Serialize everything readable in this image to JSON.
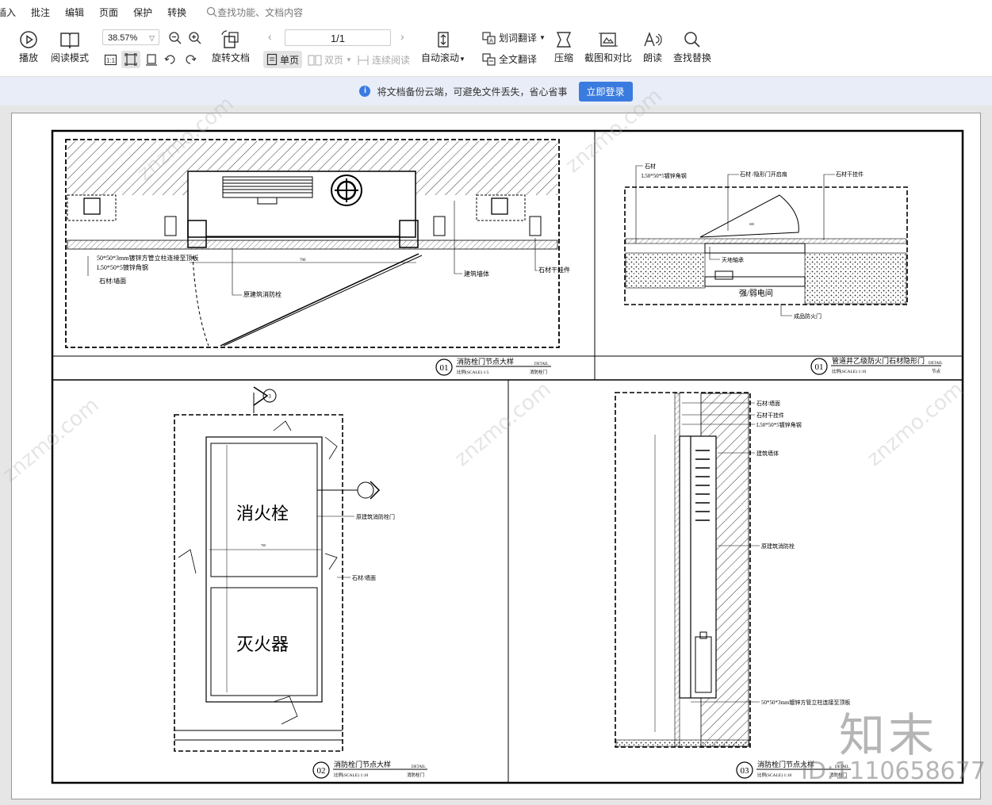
{
  "menu": {
    "items": [
      "插入",
      "批注",
      "编辑",
      "页面",
      "保护",
      "转换"
    ],
    "search_placeholder": "查找功能、文档内容"
  },
  "toolbar": {
    "play": "播放",
    "read_mode": "阅读模式",
    "zoom": "38.57%",
    "rotate": "旋转文档",
    "page": "1/1",
    "single": "单页",
    "double": "双页",
    "continuous": "连续阅读",
    "autoscroll": "自动滚动",
    "word_translate": "划词翻译",
    "full_translate": "全文翻译",
    "compress": "压缩",
    "screenshot": "截图和对比",
    "read_aloud": "朗读",
    "find_replace": "查找替换"
  },
  "notice": {
    "text": "将文档备份云端，可避免文件丢失，省心省事",
    "button": "立即登录"
  },
  "drawing": {
    "p1": {
      "labels": [
        "50*50*3mm镀锌方管立柱连接至顶板",
        "L50*50*5镀锌角钢",
        "石材/墙面",
        "原建筑消防栓",
        "建筑墙体",
        "石材干挂件"
      ],
      "dim": "700",
      "num": "01",
      "title": "消防栓门节点大样",
      "detail": "DETAIL",
      "scale": "比例(SCALE) 1:5",
      "sub": "消防栓门"
    },
    "p2": {
      "labels": [
        "石材",
        "L50*50*5镀锌角钢",
        "石材 /隐形门开启扇",
        "石材干挂件",
        "天地轴承",
        "强/弱电间",
        "成品防火门"
      ],
      "dim": "600",
      "num": "01",
      "title": "管道井乙级防火门石材隐形门",
      "detail": "DETAIL",
      "scale": "比例(SCALE) 1:10",
      "sub": "节点"
    },
    "p3": {
      "big1": "消火栓",
      "big2": "灭火器",
      "labels": [
        "原建筑消防栓门",
        "石材/墙面"
      ],
      "dim": "700",
      "marker_a": "3",
      "num": "02",
      "title": "消防栓门节点大样",
      "detail": "DETAIL",
      "scale": "比例(SCALE) 1:10",
      "sub": "消防栓门"
    },
    "p4": {
      "labels": [
        "石材/墙面",
        "石材干挂件",
        "L50*50*5镀锌角钢",
        "建筑墙体",
        "原建筑消防栓",
        "50*50*3mm镀锌方管立柱连接至顶板"
      ],
      "num": "03",
      "title": "消防栓门节点大样",
      "detail": "DETAIL",
      "scale": "比例(SCALE) 1:10",
      "sub": "消防栓门"
    }
  },
  "watermark": {
    "site": "znzmo.com",
    "logo": "知末",
    "id": "ID:1110658677"
  }
}
